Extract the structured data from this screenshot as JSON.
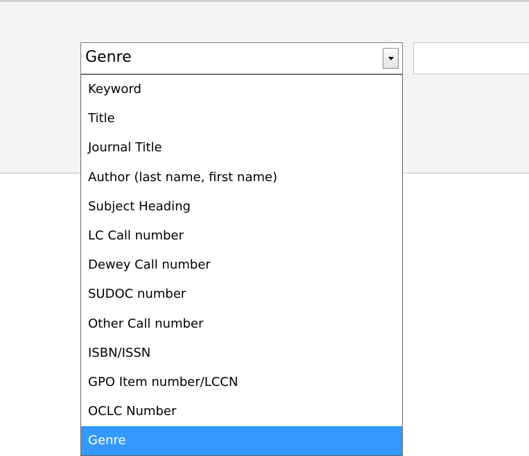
{
  "search": {
    "field_select": {
      "selected_value": "Genre",
      "options": [
        "Keyword",
        "Title",
        "Journal Title",
        "Author (last name, first name)",
        "Subject Heading",
        "LC Call number",
        "Dewey Call number",
        "SUDOC number",
        "Other Call number",
        "ISBN/ISSN",
        "GPO Item number/LCCN",
        "OCLC Number",
        "Genre"
      ],
      "highlighted_option": "Genre",
      "arrow_icon": "chevron-down-icon"
    },
    "query_input": {
      "value": "",
      "placeholder": ""
    }
  },
  "colors": {
    "panel_background": "#f4f4f4",
    "highlight_background": "#3399ff",
    "highlight_text": "#ffffff"
  }
}
